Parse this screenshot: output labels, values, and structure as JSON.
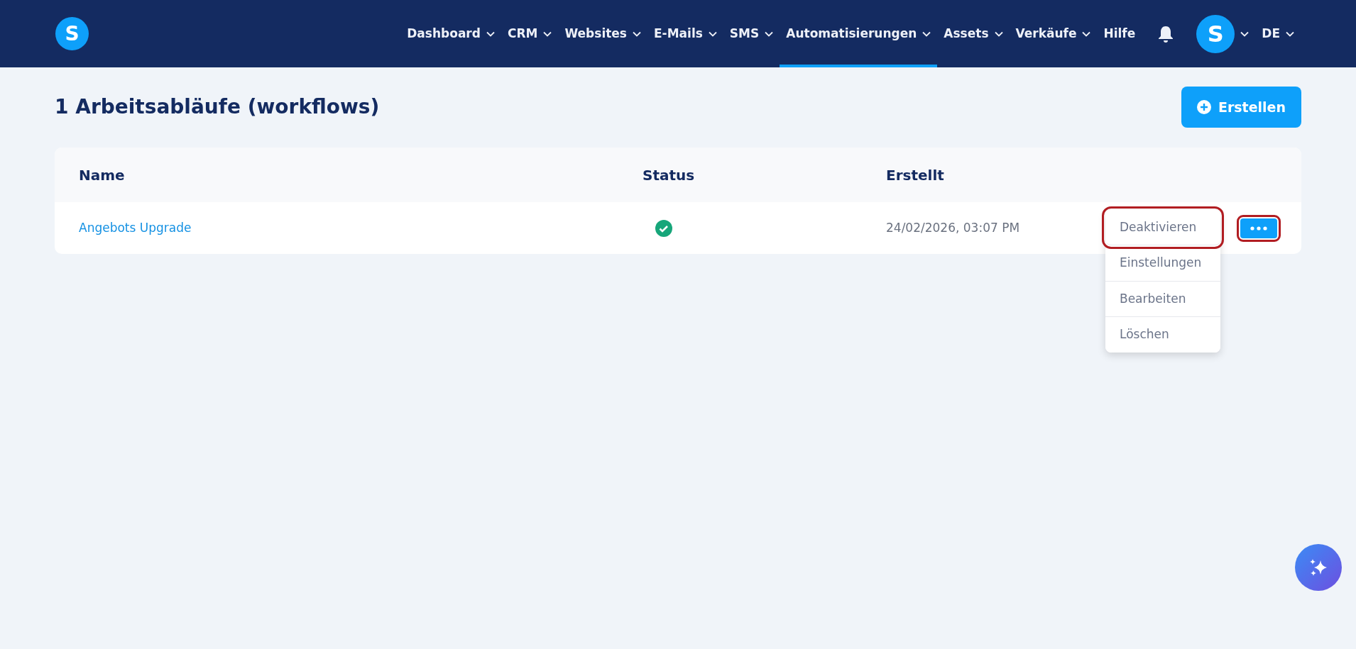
{
  "logo": {
    "letter": "S"
  },
  "nav": [
    {
      "label": "Dashboard",
      "dropdown": true,
      "selected": false
    },
    {
      "label": "CRM",
      "dropdown": true,
      "selected": false
    },
    {
      "label": "Websites",
      "dropdown": true,
      "selected": false
    },
    {
      "label": "E-Mails",
      "dropdown": true,
      "selected": false
    },
    {
      "label": "SMS",
      "dropdown": true,
      "selected": false
    },
    {
      "label": "Automatisierungen",
      "dropdown": true,
      "selected": true
    },
    {
      "label": "Assets",
      "dropdown": true,
      "selected": false
    },
    {
      "label": "Verkäufe",
      "dropdown": true,
      "selected": false
    },
    {
      "label": "Hilfe",
      "dropdown": false,
      "selected": false
    }
  ],
  "avatar": {
    "letter": "S"
  },
  "language": "DE",
  "page_title": "1 Arbeitsabläufe (workflows)",
  "create_button": "Erstellen",
  "table": {
    "columns": [
      "Name",
      "Status",
      "Erstellt"
    ],
    "rows": [
      {
        "name": "Angebots Upgrade",
        "active": true,
        "created": "24/02/2026, 03:07 PM",
        "menu_highlighted": true
      }
    ]
  },
  "menu": [
    {
      "label": "Deaktivieren",
      "highlighted": true
    },
    {
      "label": "Einstellungen",
      "highlighted": false
    },
    {
      "label": "Bearbeiten",
      "highlighted": false
    },
    {
      "label": "Löschen",
      "highlighted": false
    }
  ]
}
